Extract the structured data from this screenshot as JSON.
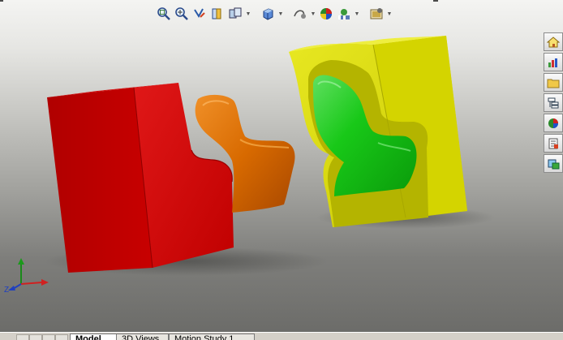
{
  "heads_up_toolbar": {
    "buttons": [
      {
        "name": "zoom-to-fit-icon"
      },
      {
        "name": "zoom-to-area-icon"
      },
      {
        "name": "previous-view-icon"
      },
      {
        "name": "section-view-icon"
      },
      {
        "name": "view-orientation-icon",
        "dropdown": true
      },
      {
        "name": "display-style-icon",
        "dropdown": true
      },
      {
        "name": "hide-show-items-icon",
        "dropdown": true
      },
      {
        "name": "edit-appearance-icon"
      },
      {
        "name": "apply-scene-icon",
        "dropdown": true
      },
      {
        "name": "view-settings-icon",
        "dropdown": true
      }
    ]
  },
  "task_pane": {
    "buttons": [
      "home-icon",
      "resources-icon",
      "folder-icon",
      "file-explorer-icon",
      "appearances-icon",
      "custom-properties-icon",
      "search-icon"
    ]
  },
  "scene_colors": {
    "red_mold": "#c00000",
    "chair_orange": "#e07000",
    "yellow_mold": "#d8d800",
    "chair_green": "#10c010"
  },
  "triad": {
    "z_label": "Z"
  },
  "bottom_tabs": [
    {
      "label": "Model",
      "active": true
    },
    {
      "label": "3D Views",
      "active": false
    },
    {
      "label": "Motion Study 1",
      "active": false
    }
  ]
}
